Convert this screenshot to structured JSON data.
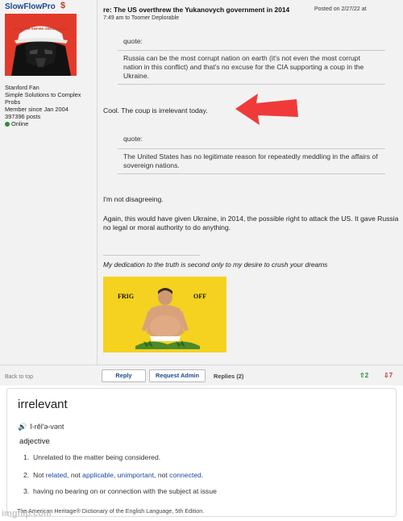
{
  "post": {
    "author": {
      "username": "SlowFlowPro",
      "badge": "$",
      "hat_text": "MAKE THE EMPIRE GREAT AGAIN",
      "meta_lines": [
        "Stanford Fan",
        "Simple Solutions to Complex Probs",
        "Member since Jan 2004",
        "397396 posts"
      ],
      "status": "Online"
    },
    "title": "re: The US overthrew the Yukanovych government in 2014",
    "posted_on": "Posted on 2/27/22 at",
    "posted_time": "7:49 am to Toomer Deplorable",
    "quote1": {
      "label": "quote:",
      "text": "Russia can be the most corrupt nation on earth (it's not even the most corrupt nation in this conflict) and that's no excuse for the CIA supporting a coup in the Ukraine."
    },
    "reply1": "Cool. The coup is irrelevant today.",
    "quote2": {
      "label": "quote:",
      "text": "The United States has no legitimate reason for repeatedly meddling in the affairs of sovereign nations."
    },
    "reply2": "I'm not disagreeing.",
    "reply3": "Again, this would have given Ukraine, in 2014, the possible right to attack the US. It gave Russia no legal or moral authority to do anything.",
    "signature": "My dedication to the truth is second only to my desire to crush your dreams",
    "flag_left": "FRIG",
    "flag_right": "OFF"
  },
  "footer": {
    "back_to_top": "Back to top",
    "reply_button": "Reply",
    "request_admin_button": "Request Admin",
    "replies": "Replies (2)",
    "upvotes": "2",
    "downvotes": "7"
  },
  "dictionary": {
    "word": "irrelevant",
    "pronunciation": "ĭ-rĕl′ə-vənt",
    "part_of_speech": "adjective",
    "sense1": "Unrelated to the matter being considered.",
    "sense2_not": "Not",
    "sense2_related": "related",
    "sense2_not2": ", not",
    "sense2_applicable": "applicable",
    "sense2_unimportant": "unimportant",
    "sense2_not3": ", not",
    "sense2_connected": "connected",
    "sense3": "having no bearing on or connection with the subject at issue",
    "source": "The American Heritage® Dictionary of the English Language, 5th Edition."
  },
  "watermark": "imgflip.com",
  "colors": {
    "username": "#1a4a8a",
    "arrow": "#f03a3a",
    "upvote": "#2d8f3a",
    "downvote": "#c0392b",
    "flag": "#f4d21f"
  }
}
